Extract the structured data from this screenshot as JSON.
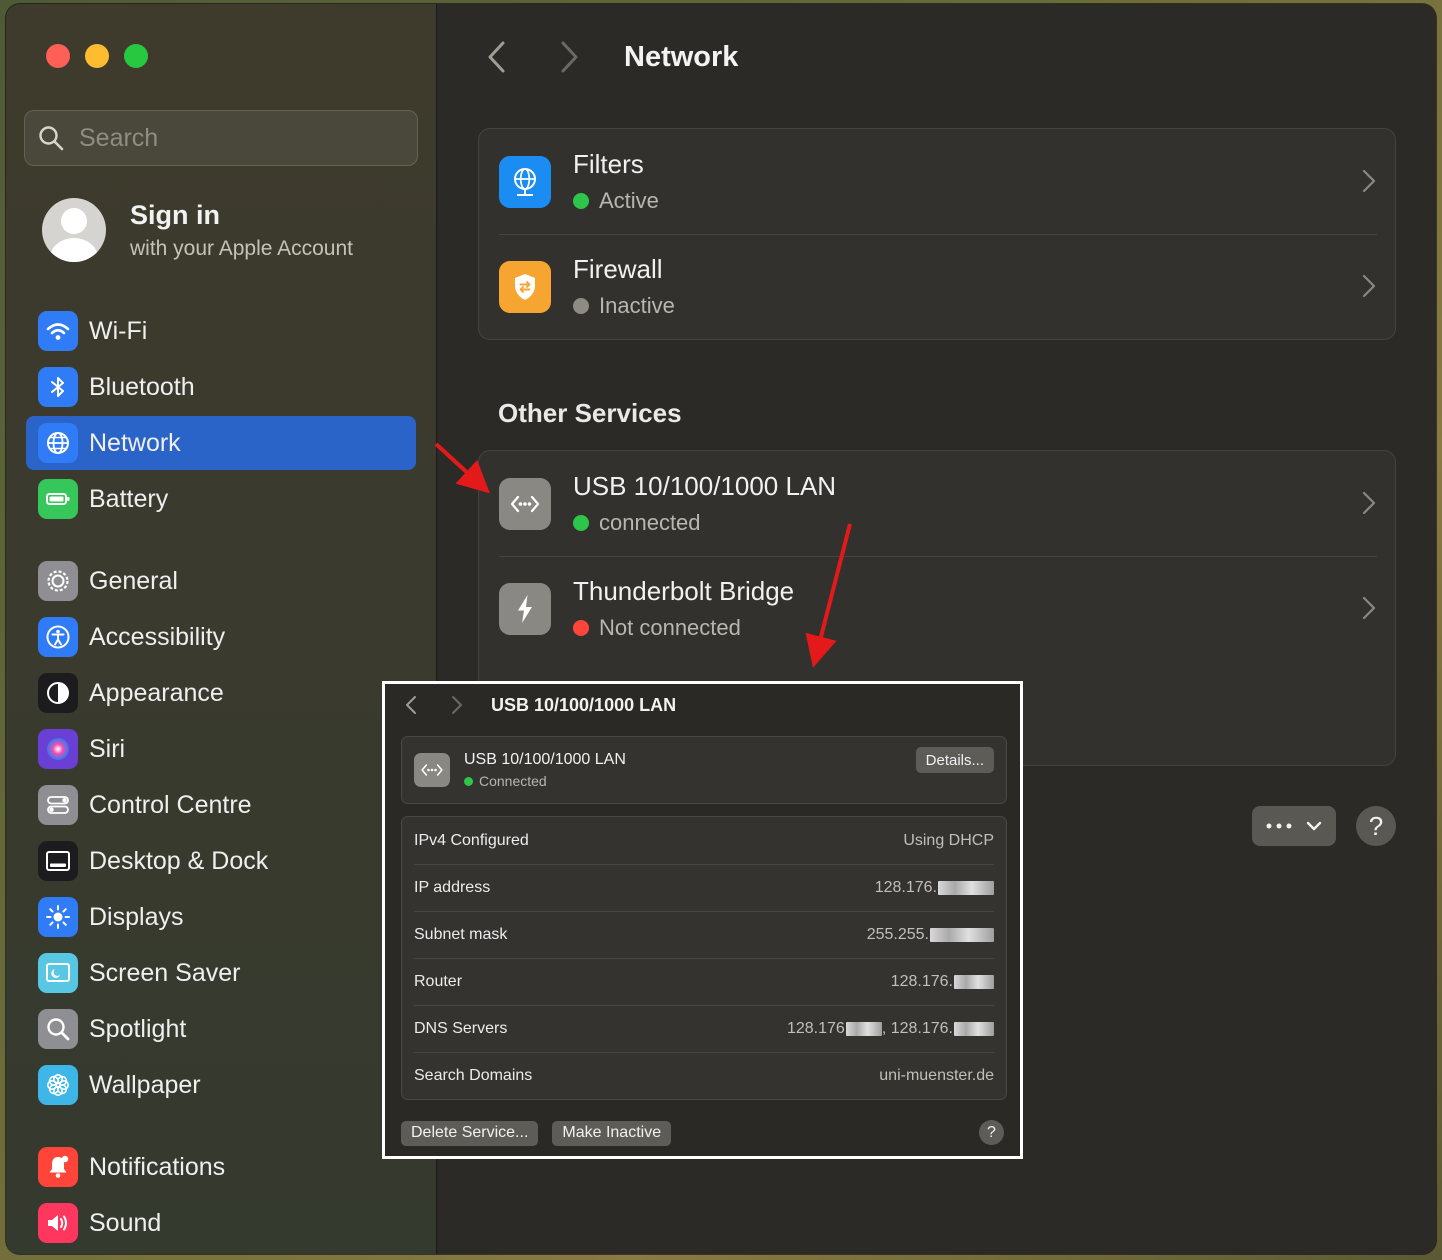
{
  "sidebar": {
    "search": {
      "placeholder": "Search"
    },
    "account": {
      "title": "Sign in",
      "subtitle": "with your Apple Account"
    },
    "groups": [
      [
        {
          "label": "Wi-Fi",
          "icon": "wifi-icon",
          "color": "#2f7cf6",
          "active": false
        },
        {
          "label": "Bluetooth",
          "icon": "bluetooth-icon",
          "color": "#2f7cf6",
          "active": false
        },
        {
          "label": "Network",
          "icon": "globe-icon",
          "color": "#2f7cf6",
          "active": true
        },
        {
          "label": "Battery",
          "icon": "battery-icon",
          "color": "#35c759",
          "active": false
        }
      ],
      [
        {
          "label": "General",
          "icon": "gear-icon",
          "color": "#8e8e93",
          "active": false
        },
        {
          "label": "Accessibility",
          "icon": "accessibility-icon",
          "color": "#2f7cf6",
          "active": false
        },
        {
          "label": "Appearance",
          "icon": "appearance-icon",
          "color": "#1c1c1e",
          "active": false
        },
        {
          "label": "Siri",
          "icon": "siri-icon",
          "color": "#6a3fd6",
          "active": false
        },
        {
          "label": "Control Centre",
          "icon": "control-centre-icon",
          "color": "#8e8e93",
          "active": false
        },
        {
          "label": "Desktop & Dock",
          "icon": "dock-icon",
          "color": "#1c1c1e",
          "active": false
        },
        {
          "label": "Displays",
          "icon": "displays-icon",
          "color": "#2f7cf6",
          "active": false
        },
        {
          "label": "Screen Saver",
          "icon": "screen-saver-icon",
          "color": "#57c7e4",
          "active": false
        },
        {
          "label": "Spotlight",
          "icon": "spotlight-icon",
          "color": "#8e8e93",
          "active": false
        },
        {
          "label": "Wallpaper",
          "icon": "wallpaper-icon",
          "color": "#3fb6e8",
          "active": false
        }
      ],
      [
        {
          "label": "Notifications",
          "icon": "notifications-icon",
          "color": "#ff453a",
          "active": false
        },
        {
          "label": "Sound",
          "icon": "sound-icon",
          "color": "#ff375f",
          "active": false
        }
      ]
    ]
  },
  "main": {
    "title": "Network",
    "security": [
      {
        "title": "Filters",
        "status": "Active",
        "status_color": "green",
        "icon": "filter-globe-icon",
        "icon_color": "#1a8cf2"
      },
      {
        "title": "Firewall",
        "status": "Inactive",
        "status_color": "gray",
        "icon": "firewall-shield-icon",
        "icon_color": "#f7a531"
      }
    ],
    "other_services_title": "Other Services",
    "services": [
      {
        "title": "USB 10/100/1000 LAN",
        "status": "connected",
        "status_color": "green",
        "icon": "ethernet-icon"
      },
      {
        "title": "Thunderbolt Bridge",
        "status": "Not connected",
        "status_color": "red",
        "icon": "thunderbolt-icon"
      }
    ],
    "more_button": {
      "icon": "ellipsis-icon"
    },
    "help_label": "?"
  },
  "detail": {
    "title": "USB 10/100/1000 LAN",
    "service": {
      "title": "USB 10/100/1000 LAN",
      "status": "Connected",
      "details_label": "Details..."
    },
    "info": [
      {
        "label": "IPv4 Configured",
        "value": "Using DHCP"
      },
      {
        "label": "IP address",
        "value": "128.176."
      },
      {
        "label": "Subnet mask",
        "value": "255.255."
      },
      {
        "label": "Router",
        "value": "128.176."
      },
      {
        "label": "DNS Servers",
        "value": "128.176",
        "value2": ", 128.176."
      },
      {
        "label": "Search Domains",
        "value": "uni-muenster.de"
      }
    ],
    "delete_label": "Delete Service...",
    "inactive_label": "Make Inactive",
    "help_label": "?"
  }
}
